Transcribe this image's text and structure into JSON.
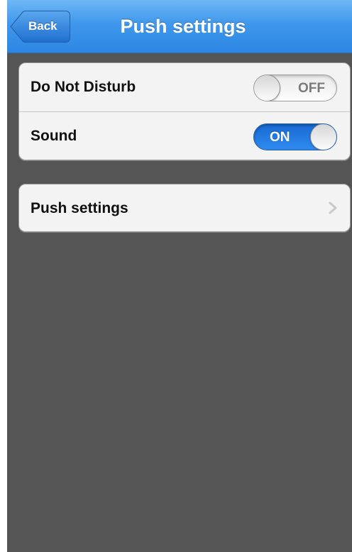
{
  "navbar": {
    "title": "Push settings",
    "back_label": "Back",
    "accent_color": "#3f98ec"
  },
  "settings_group": {
    "items": [
      {
        "label": "Do Not Disturb",
        "state": "OFF",
        "enabled": false
      },
      {
        "label": "Sound",
        "state": "ON",
        "enabled": true
      }
    ]
  },
  "link_group": {
    "items": [
      {
        "label": "Push settings",
        "icon": "chevron-right-icon"
      }
    ]
  }
}
